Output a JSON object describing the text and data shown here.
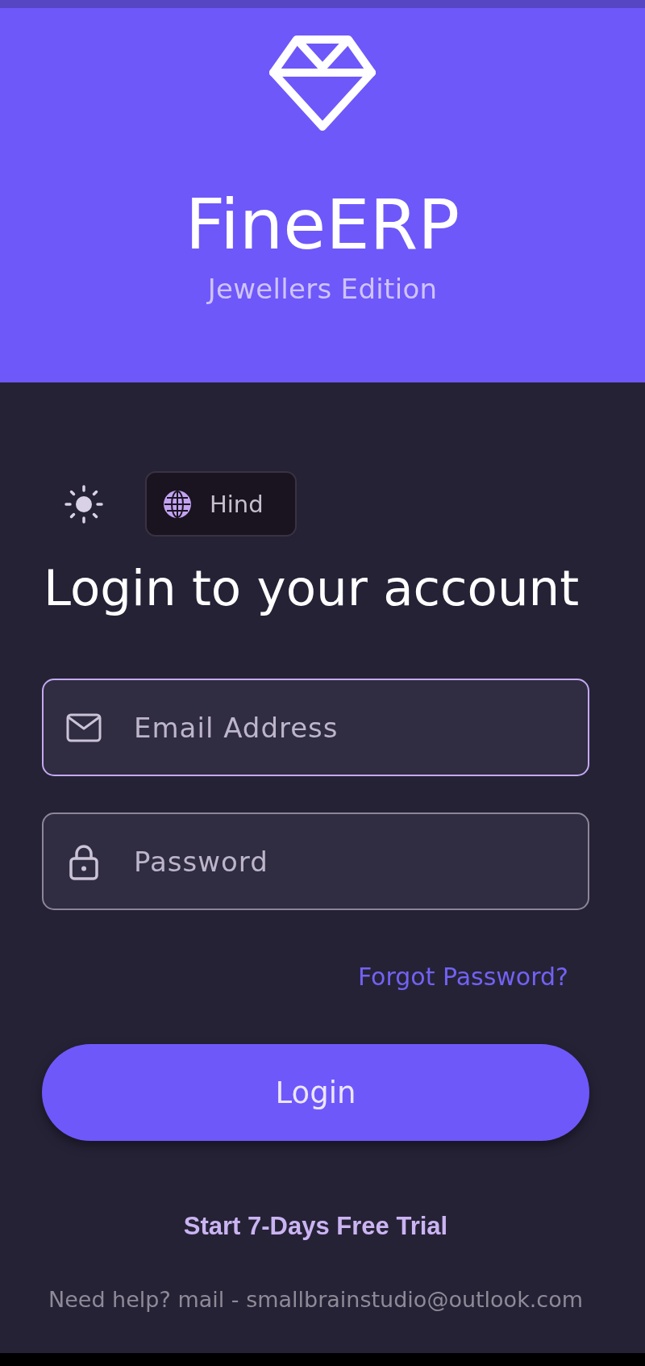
{
  "header": {
    "app_name": "FineERP",
    "edition": "Jewellers Edition"
  },
  "language_button": {
    "label": "Hind"
  },
  "title": "Login to your account",
  "fields": [
    {
      "kind": "email",
      "placeholder": "Email Address",
      "focused": true
    },
    {
      "kind": "password",
      "placeholder": "Password",
      "focused": false
    }
  ],
  "forgot_link": "Forgot Password?",
  "login_button": "Login",
  "trial_link": "Start 7-Days Free Trial",
  "help_text": "Need help? mail - smallbrainstudio@outlook.com"
}
